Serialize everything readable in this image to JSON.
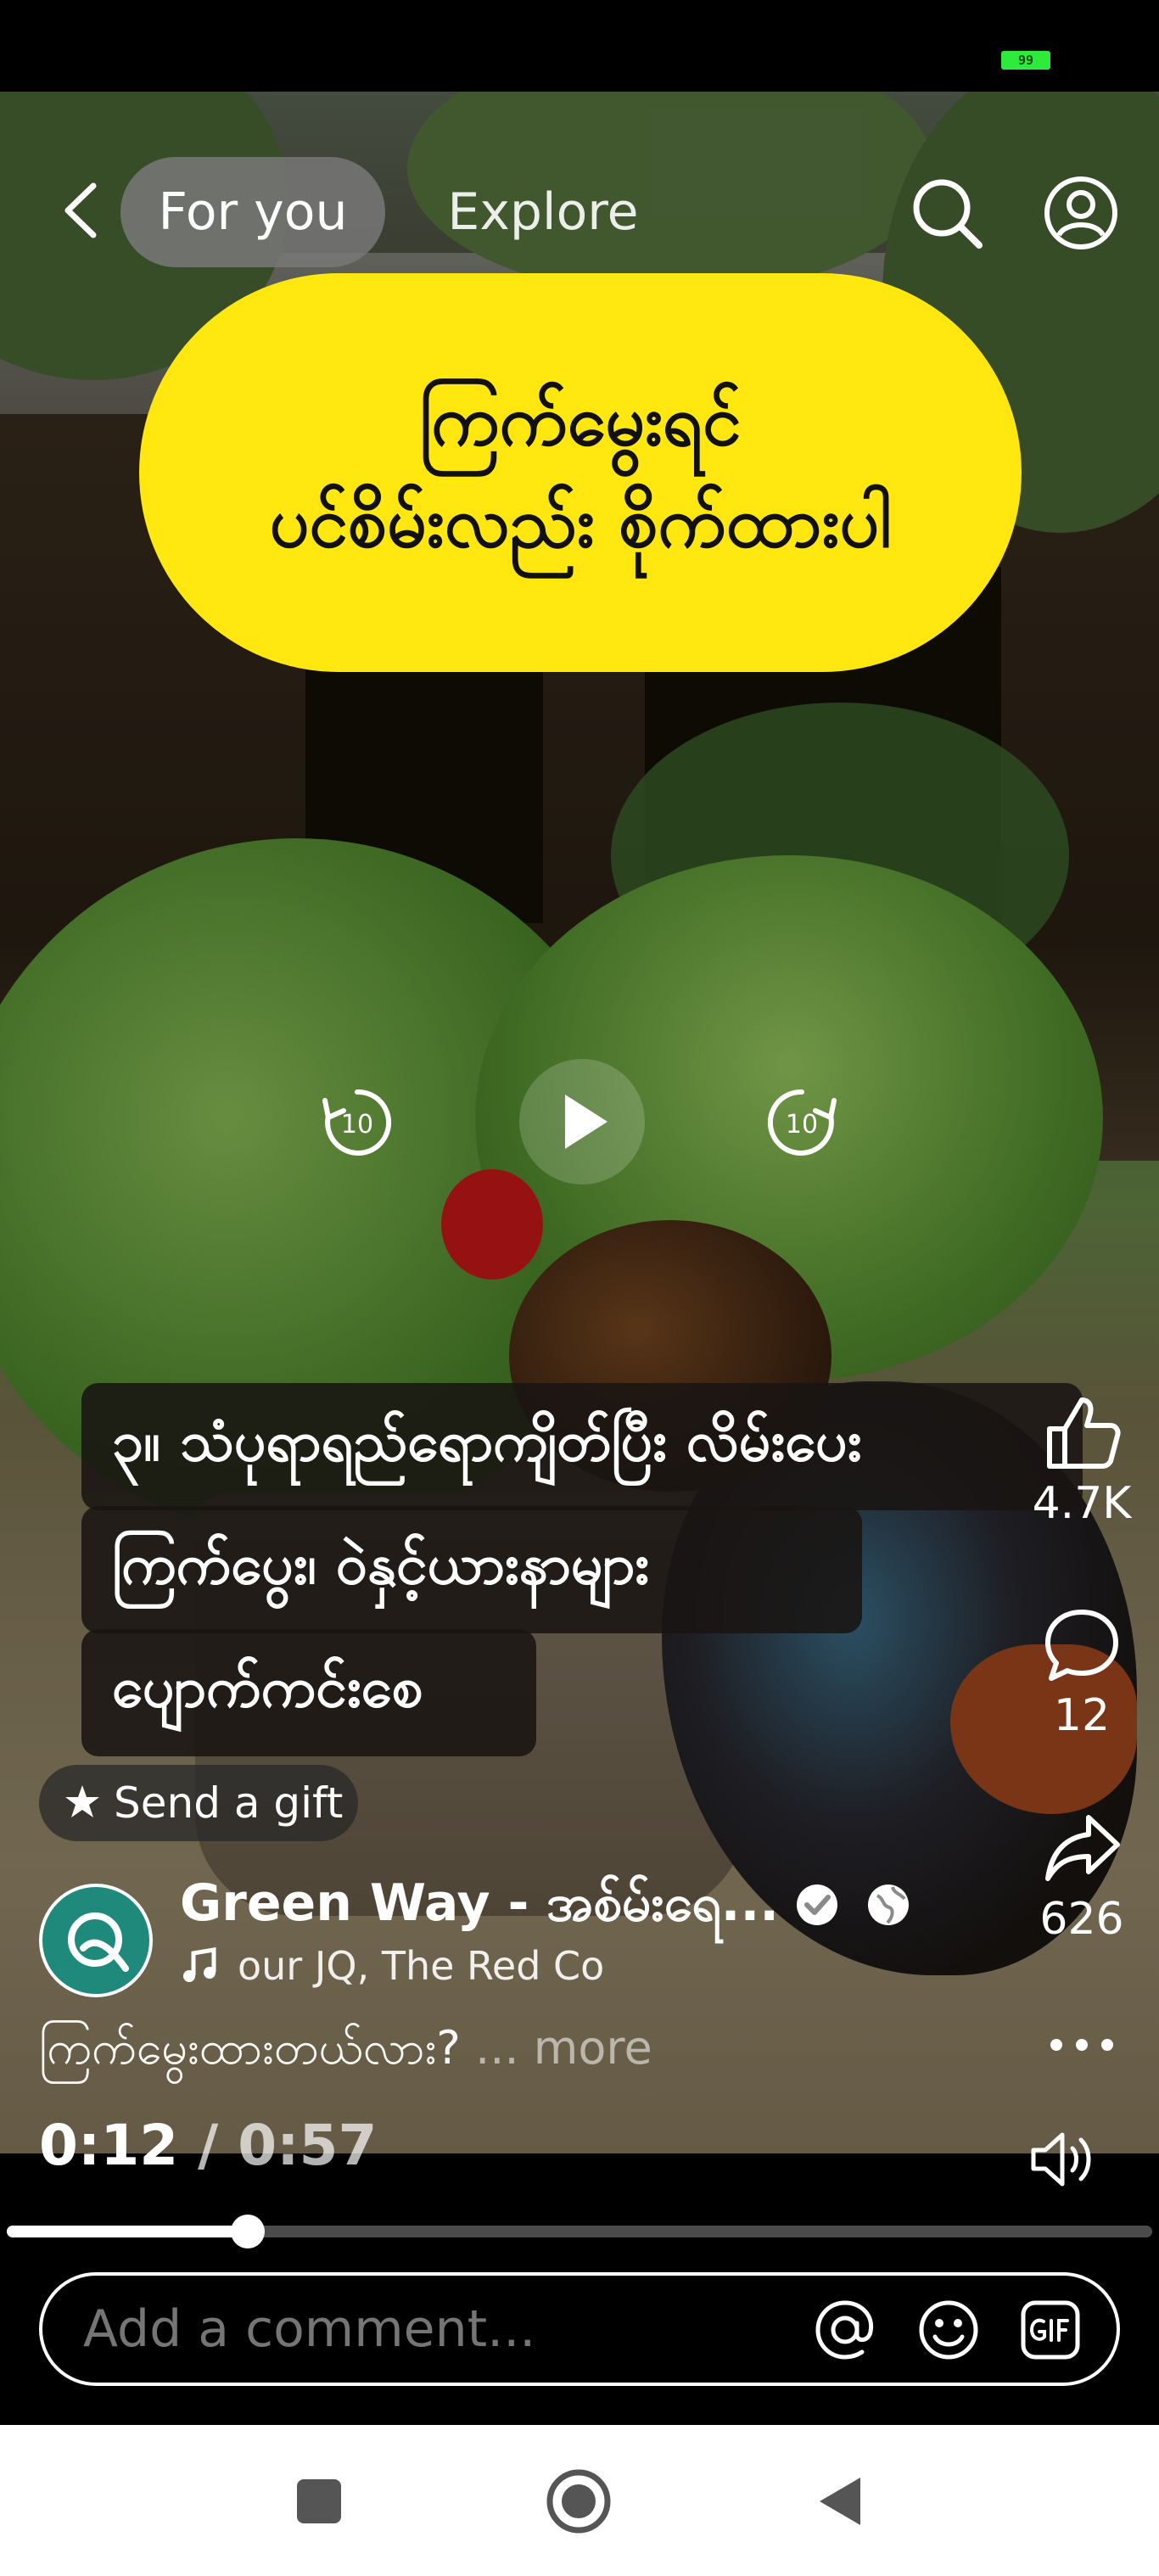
{
  "status_bar": {
    "battery_level": "99"
  },
  "header": {
    "tabs": [
      {
        "label": "For you",
        "active": true
      },
      {
        "label": "Explore",
        "active": false
      }
    ]
  },
  "video": {
    "title_overlay": {
      "line1": "ကြက်မွေးရင်",
      "line2": "ပင်စိမ်းလည်း စိုက်ထားပါ"
    },
    "caption": {
      "line1": "၃။ သံပုရာရည်ရောကျိတ်ပြီး လိမ်းပေး",
      "line2": "ကြက်ပွေး၊ ဝဲနှင့်ယားနာများ",
      "line3": "ပျောက်ကင်းစေ"
    },
    "skip_back_seconds": "10",
    "skip_forward_seconds": "10"
  },
  "actions": {
    "likes": "4.7K",
    "comments": "12",
    "shares": "626"
  },
  "post": {
    "gift_label": "Send a gift",
    "page_name": "Green Way - အစ်မ်းရေ...",
    "music": "our   JQ, The Red Co",
    "text": "ကြက်မွေးထားတယ်လား?",
    "more_label": "... more"
  },
  "player": {
    "current_time": "0:12",
    "separator": " / ",
    "duration": "0:57",
    "progress": 0.21
  },
  "comment": {
    "placeholder": "Add a comment..."
  },
  "colors": {
    "title_bubble": "#ffe70f",
    "avatar": "#1f8a7c",
    "battery": "#2eea3a"
  }
}
